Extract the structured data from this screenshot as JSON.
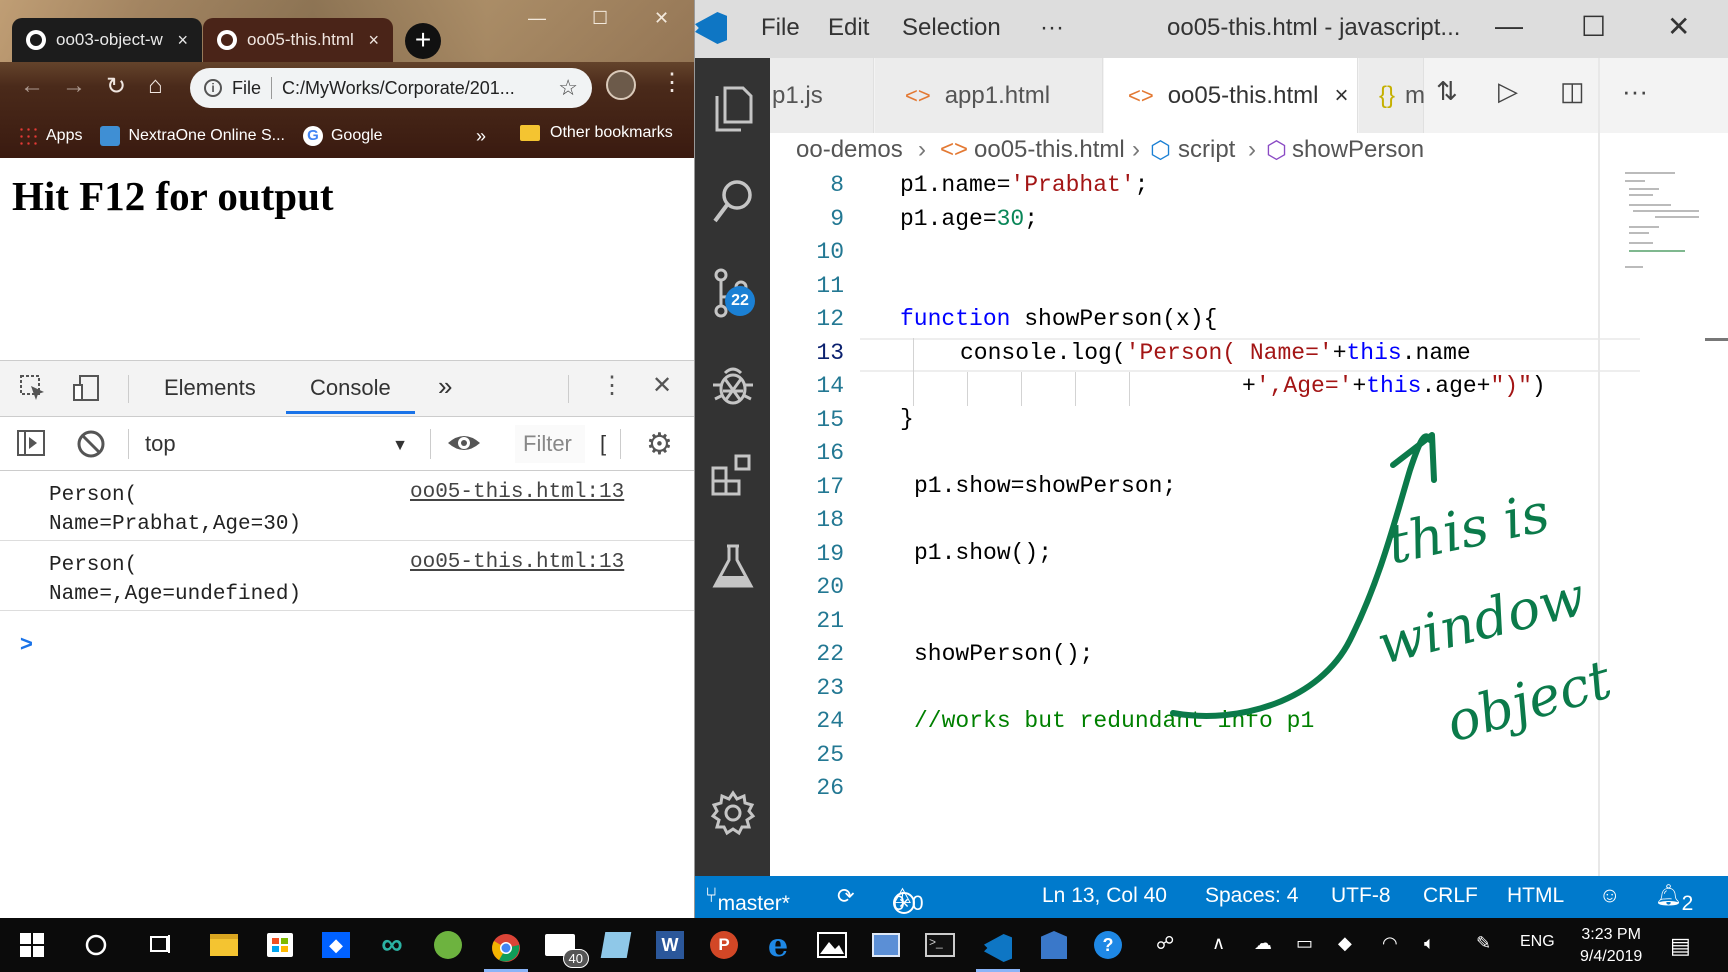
{
  "chrome": {
    "tabs": [
      {
        "title": "oo03-object-w",
        "close": "×"
      },
      {
        "title": "oo05-this.html",
        "close": "×"
      }
    ],
    "new_tab": "+",
    "omnibox": {
      "scheme": "File",
      "url": "C:/MyWorks/Corporate/201..."
    },
    "bookmarks": [
      {
        "label": "Apps",
        "color": "#e53935"
      },
      {
        "label": "NextraOne Online S...",
        "color": "#3f8fd4"
      },
      {
        "label": "Google",
        "color": "#4285f4"
      }
    ],
    "bookmarks_more": "»",
    "other_bookmarks": "Other bookmarks",
    "page_heading": "Hit F12 for output",
    "devtools": {
      "tabs": [
        "Elements",
        "Console"
      ],
      "more": "»",
      "context": "top",
      "filter_placeholder": "Filter",
      "filter_extra": "[",
      "logs": [
        {
          "message": "Person(\nName=Prabhat,Age=30)",
          "source": "oo05-this.html:13"
        },
        {
          "message": "Person(\nName=,Age=undefined)",
          "source": "oo05-this.html:13"
        }
      ],
      "prompt": ">"
    }
  },
  "vscode": {
    "menu": [
      "File",
      "Edit",
      "Selection",
      "···"
    ],
    "window_title": "oo05-this.html - javascript...",
    "badge": "22",
    "tabs": [
      {
        "label": "p1.js"
      },
      {
        "label": "app1.html"
      },
      {
        "label": "oo05-this.html",
        "close": "×"
      },
      {
        "label": "m"
      }
    ],
    "breadcrumb": [
      "oo-demos",
      "oo05-this.html",
      "script",
      "showPerson"
    ],
    "line_numbers": [
      "8",
      "9",
      "10",
      "11",
      "12",
      "13",
      "14",
      "15",
      "16",
      "17",
      "18",
      "19",
      "20",
      "21",
      "22",
      "23",
      "24",
      "25",
      "26"
    ],
    "current_line": "13",
    "code": {
      "l8_a": "p1.name=",
      "l8_b": "'Prabhat'",
      "l8_c": ";",
      "l9_a": "p1.age=",
      "l9_b": "30",
      "l9_c": ";",
      "l12_a": "function",
      "l12_b": " showPerson(x){",
      "l13_a": "console.log(",
      "l13_b": "'Person( Name='",
      "l13_c": "+",
      "l13_d": "this",
      "l13_e": ".name",
      "l14_a": "+",
      "l14_b": "',Age='",
      "l14_c": "+",
      "l14_d": "this",
      "l14_e": ".age+",
      "l14_f": "\")\"",
      "l14_g": ")",
      "l15": "}",
      "l17": "p1.show=showPerson;",
      "l19": "p1.show();",
      "l22": "showPerson();",
      "l24": "//works but redundant info p1"
    },
    "annotation": "this is window object",
    "status": {
      "branch": "master*",
      "errors": "0",
      "warnings": "0",
      "position": "Ln 13, Col 40",
      "spaces": "Spaces: 4",
      "encoding": "UTF-8",
      "eol": "CRLF",
      "language": "HTML",
      "notifications": "2"
    }
  },
  "taskbar": {
    "mail_badge": "40",
    "language": "ENG",
    "time": "3:23 PM",
    "date": "9/4/2019"
  },
  "colors": {
    "vscode_accent": "#007acc",
    "annotation_ink": "#0b7a4a",
    "keyword": "#0000ff",
    "string": "#a31515",
    "number": "#098658",
    "comment": "#008000"
  }
}
